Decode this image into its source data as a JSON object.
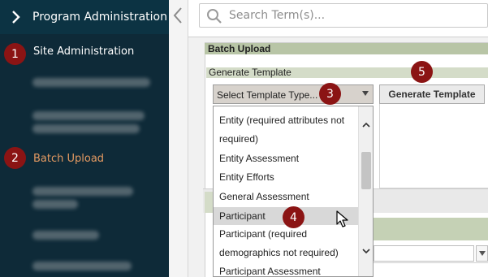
{
  "sidebar": {
    "header_label": "Program Administration",
    "site_admin_label": "Site Administration",
    "batch_upload_label": "Batch Upload"
  },
  "search": {
    "placeholder": "Search Term(s)..."
  },
  "main": {
    "section_title": "Batch Upload",
    "subsection_title": "Generate Template",
    "select_value": "Select Template Type...",
    "generate_button_label": "Generate Template",
    "dropdown_options": [
      "Entity (required attributes not",
      "required)",
      "Entity Assessment",
      "Entity Efforts",
      "General Assessment",
      "Participant",
      "Participant (required",
      "demographics not required)",
      "Participant Assessment"
    ],
    "selected_option": "Participant"
  },
  "badges": [
    "1",
    "2",
    "3",
    "4",
    "5"
  ],
  "colors": {
    "sidebar_bg": "#0e2a38",
    "active_item": "#e49a62",
    "badge": "#8b1414",
    "section_bar": "#b8c5a6"
  }
}
